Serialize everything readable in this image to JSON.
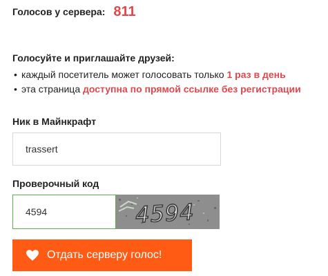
{
  "votes": {
    "label": "Голосов у сервера:",
    "count": "811"
  },
  "info": {
    "title": "Голосуйте и приглашайте друзей:",
    "items": [
      {
        "text": "каждый посетитель может голосовать только ",
        "highlight": "1 раз в день"
      },
      {
        "text": "эта страница ",
        "highlight": "доступна по прямой ссылке без регистрации"
      }
    ]
  },
  "nick": {
    "label": "Ник в Майнкрафт",
    "value": "trassert"
  },
  "captcha": {
    "label": "Проверочный код",
    "value": "4594",
    "image_text": "4594"
  },
  "vote_button": {
    "label": "Отдать серверу голос!",
    "icon": "heart-icon"
  },
  "colors": {
    "accent_red": "#e0474c",
    "button_orange": "#ff5b14",
    "focus_green": "#5cab4d"
  }
}
